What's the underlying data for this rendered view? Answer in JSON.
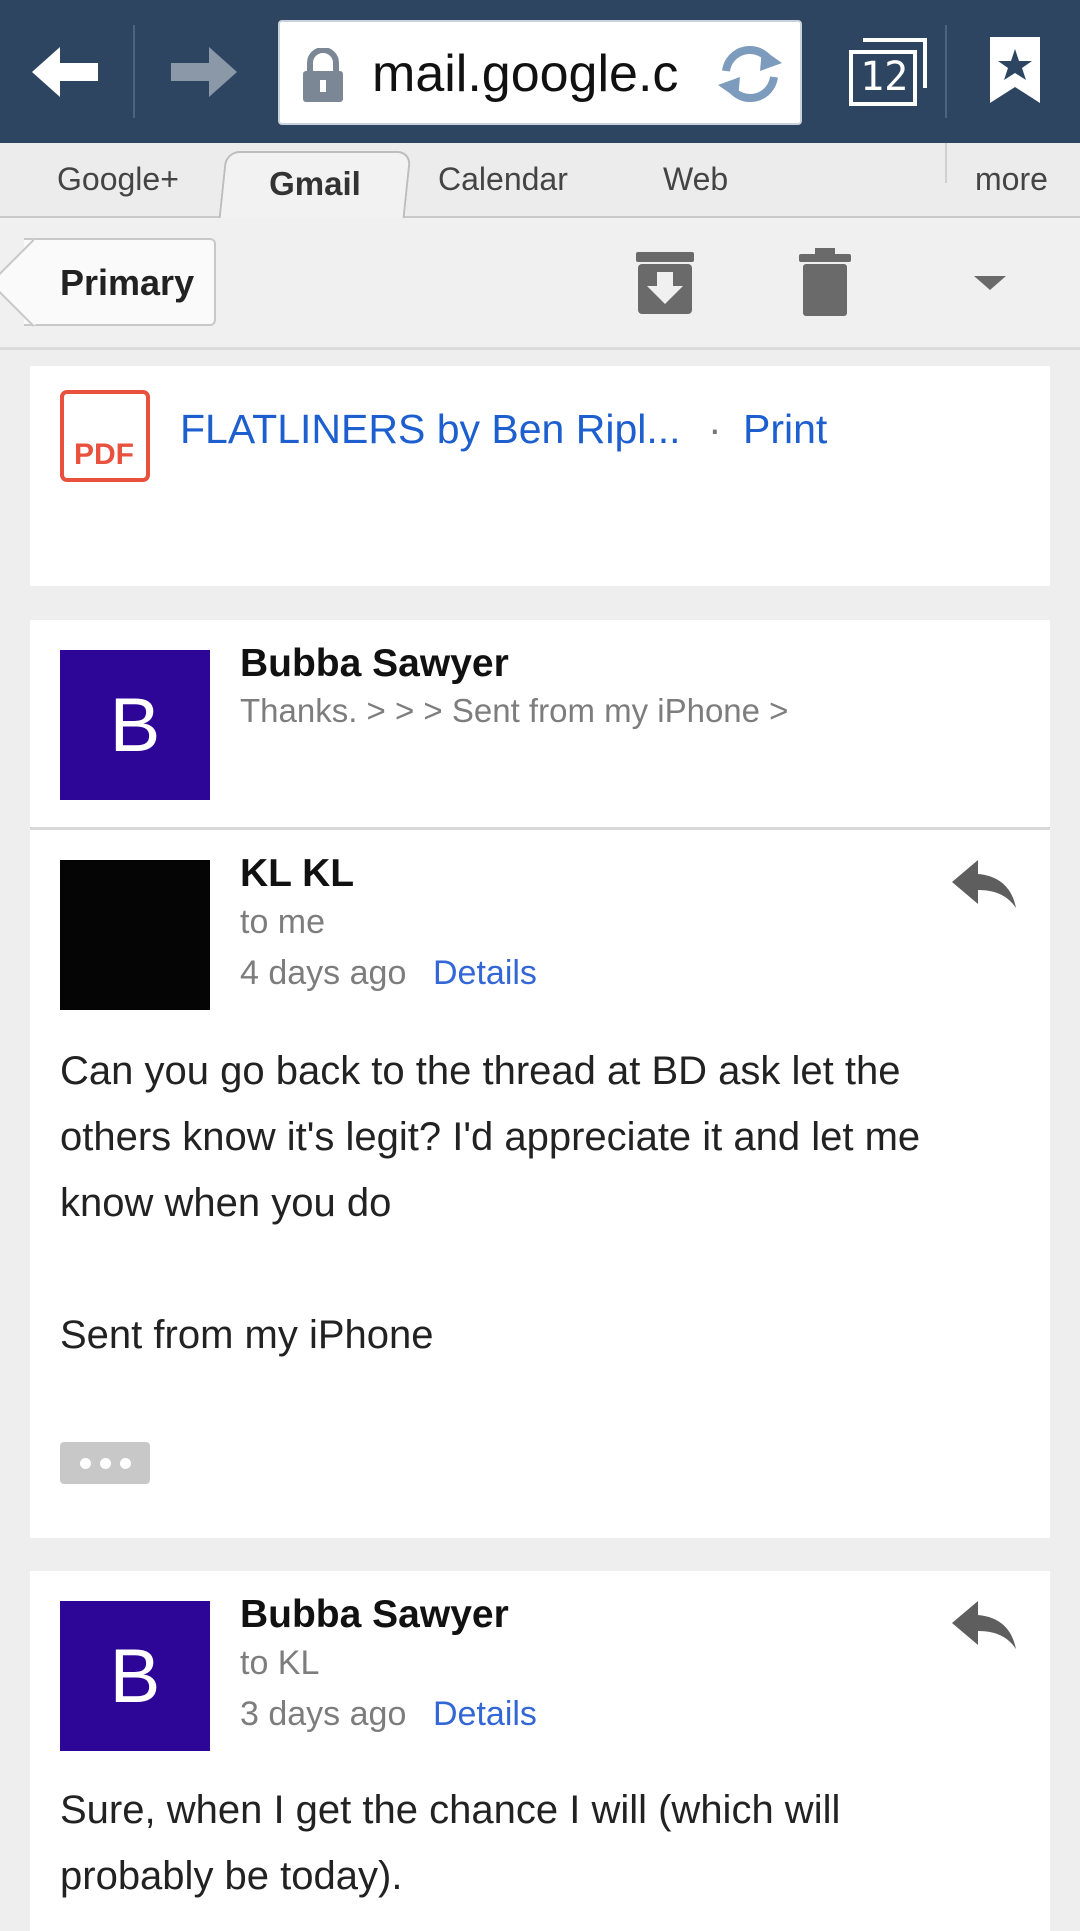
{
  "browser": {
    "url": "mail.google.c",
    "tab_count": "12"
  },
  "google_nav": {
    "tabs": [
      {
        "label": "Google+"
      },
      {
        "label": "Gmail"
      },
      {
        "label": "Calendar"
      },
      {
        "label": "Web"
      }
    ],
    "more_label": "more"
  },
  "action_bar": {
    "primary_label": "Primary"
  },
  "attachment": {
    "icon_text": "PDF",
    "name": "FLATLINERS by Ben Ripl...",
    "separator": "·",
    "print_label": "Print"
  },
  "messages": [
    {
      "avatar_letter": "B",
      "sender": "Bubba Sawyer",
      "snippet": "Thanks. > > > Sent from my iPhone >"
    },
    {
      "avatar_letter": "",
      "sender": "KL KL",
      "recipient": "to me",
      "time": "4 days ago",
      "details_label": "Details",
      "body": [
        "Can you go back to the thread at BD ask let the",
        "others know it's legit? I'd appreciate it and let me",
        "know when you do",
        "",
        "Sent from my iPhone"
      ]
    },
    {
      "avatar_letter": "B",
      "sender": "Bubba Sawyer",
      "recipient": "to KL",
      "time": "3 days ago",
      "details_label": "Details",
      "body": [
        "Sure, when I get the chance I will (which will",
        "probably be today)."
      ]
    }
  ],
  "colors": {
    "topbar": "#2d4560",
    "avatar_purple": "#2d0697",
    "link_blue": "#3367d6",
    "pdf_red": "#e8513d"
  },
  "icons": [
    "back-arrow-icon",
    "forward-arrow-icon",
    "lock-icon",
    "reload-icon",
    "tabs-icon",
    "bookmark-icon",
    "archive-icon",
    "trash-icon",
    "dropdown-icon",
    "pdf-icon",
    "reply-icon",
    "ellipsis-icon"
  ]
}
